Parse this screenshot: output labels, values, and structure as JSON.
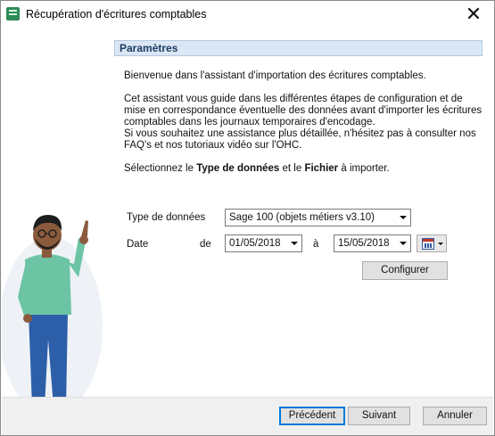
{
  "window": {
    "title": "Récupération d'écritures comptables",
    "app_icon": "sage-app-icon",
    "close_glyph": "✕"
  },
  "section": {
    "title": "Paramètres"
  },
  "intro": {
    "line1": "Bienvenue dans l'assistant d'importation des écritures comptables.",
    "line2": "Cet assistant vous guide dans les différentes étapes de configuration et de mise en correspondance éventuelle des données avant d'importer les écritures comptables dans les journaux temporaires d'encodage.",
    "line3": "Si vous souhaitez une assistance plus détaillée, n'hésitez pas à consulter nos FAQ's et nos tutoriaux vidéo sur l'OHC.",
    "select_prefix": "Sélectionnez le ",
    "select_bold1": "Type de données",
    "select_middle": " et le ",
    "select_bold2": "Fichier",
    "select_suffix": " à importer."
  },
  "form": {
    "type_label": "Type de données",
    "type_value": "Sage 100 (objets métiers v3.10)",
    "date_label": "Date",
    "from_label": "de",
    "from_value": "01/05/2018",
    "to_label": "à",
    "to_value": "15/05/2018",
    "calendar_icon": "calendar-icon",
    "configure_label": "Configurer"
  },
  "footer": {
    "previous_label": "Précédent",
    "next_label": "Suivant",
    "cancel_label": "Annuler"
  },
  "colors": {
    "section_bg": "#dbe7f4",
    "section_text": "#1f3b63",
    "default_button_border": "#0078d7",
    "shirt": "#6cc4a4",
    "pants": "#2c5fa8"
  }
}
